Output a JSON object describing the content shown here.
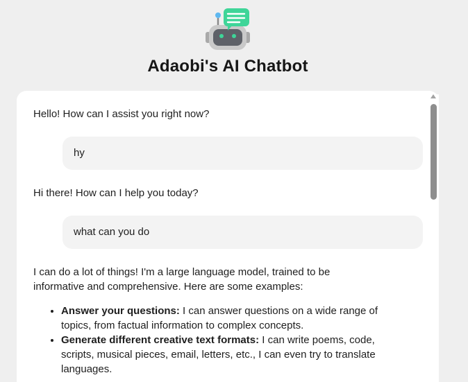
{
  "app": {
    "title": "Adaobi's AI Chatbot",
    "logo_icon": "robot-chat-icon",
    "accent_color": "#3ed598"
  },
  "messages": [
    {
      "role": "bot",
      "text": "Hello! How can I assist you right now?"
    },
    {
      "role": "user",
      "text": "hy"
    },
    {
      "role": "bot",
      "text": "Hi there! How can I help you today?"
    },
    {
      "role": "user",
      "text": "what can you do"
    }
  ],
  "long_reply": {
    "intro": "I can do a lot of things! I'm a large language model, trained to be informative and comprehensive. Here are some examples:",
    "items": [
      {
        "bold": "Answer your questions:",
        "text": " I can answer questions on a wide range of topics, from factual information to complex concepts."
      },
      {
        "bold": "Generate different creative text formats:",
        "text": " I can write poems, code, scripts, musical pieces, email, letters, etc., I can even try to translate languages."
      }
    ]
  }
}
